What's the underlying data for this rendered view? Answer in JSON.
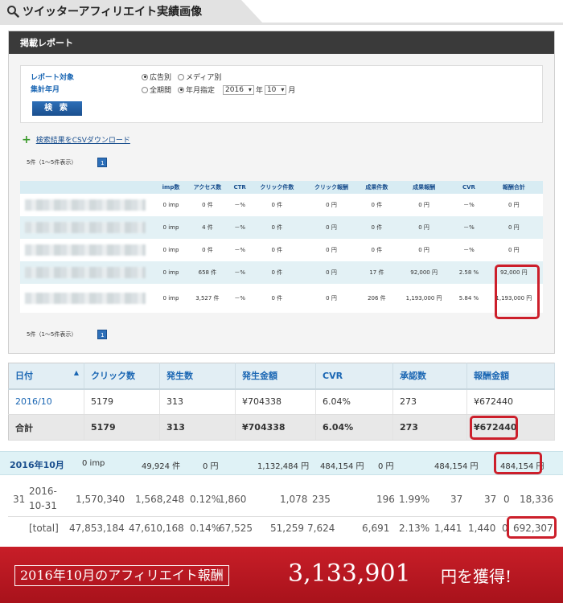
{
  "header": {
    "title": "ツイッターアフィリエイト実績画像"
  },
  "panel1": {
    "bar_title": "掲載レポート",
    "filter": {
      "label_target": "レポート対象",
      "label_period": "集計年月",
      "radio_ad": "広告別",
      "radio_media": "メディア別",
      "radio_all": "全期間",
      "radio_month": "年月指定",
      "year": "2016",
      "year_unit": "年",
      "month": "10",
      "month_unit": "月",
      "search_label": "検 索"
    },
    "csv_label": "検索結果をCSVダウンロード",
    "pager_text": "5件（1～5件表示）",
    "pager_page": "1",
    "columns": [
      "imp数",
      "アクセス数",
      "CTR",
      "クリック件数",
      "クリック報酬",
      "成果件数",
      "成果報酬",
      "CVR",
      "報酬合計"
    ],
    "rows": [
      [
        "0 imp",
        "0 件",
        "－%",
        "0 件",
        "0 円",
        "0 件",
        "0 円",
        "－%",
        "0 円"
      ],
      [
        "0 imp",
        "4 件",
        "－%",
        "0 件",
        "0 円",
        "0 件",
        "0 円",
        "－%",
        "0 円"
      ],
      [
        "0 imp",
        "0 件",
        "－%",
        "0 件",
        "0 円",
        "0 件",
        "0 円",
        "－%",
        "0 円"
      ],
      [
        "0 imp",
        "658 件",
        "－%",
        "0 件",
        "0 円",
        "17 件",
        "92,000 円",
        "2.58 %",
        "92,000 円"
      ],
      [
        "0 imp",
        "3,527 件",
        "－%",
        "0 件",
        "0 円",
        "206 件",
        "1,193,000 円",
        "5.84 %",
        "1,193,000 円"
      ]
    ]
  },
  "table2": {
    "columns": [
      "日付",
      "クリック数",
      "発生数",
      "発生金額",
      "CVR",
      "承認数",
      "報酬金額"
    ],
    "sort_icon": "▲",
    "rows": [
      [
        "2016/10",
        "5179",
        "313",
        "¥704338",
        "6.04%",
        "273",
        "¥672440"
      ],
      [
        "合計",
        "5179",
        "313",
        "¥704338",
        "6.04%",
        "273",
        "¥672440"
      ]
    ]
  },
  "row3": {
    "date": "2016年10月",
    "imp": "0 imp",
    "count": "49,924 件",
    "yen1": "0 円",
    "v1": "1,132,484 円",
    "v2": "484,154 円",
    "yen2": "0 円",
    "v3": "484,154 円",
    "v4": "484,154 円"
  },
  "table4": {
    "row1": {
      "day": "31",
      "date1": "2016-",
      "date2": "10-31",
      "c1": "1,570,340",
      "c2": "1,568,248",
      "c3": "0.12%",
      "c4": "1,860",
      "c5": "1,078",
      "c6": "235",
      "c7": "196",
      "c8": "1.99%",
      "c9": "37",
      "c10": "37",
      "c11": "0",
      "c12": "18,336"
    },
    "row2": {
      "label": "[total]",
      "c1": "47,853,184",
      "c2": "47,610,168",
      "c3": "0.14%",
      "c4": "67,525",
      "c5": "51,259",
      "c6": "7,624",
      "c7": "6,691",
      "c8": "2.13%",
      "c9": "1,441",
      "c10": "1,440",
      "c11": "0",
      "c12": "692,307"
    }
  },
  "banner": {
    "label": "2016年10月のアフィリエイト報酬",
    "amount": "3,133,901",
    "suffix": "円を獲得!"
  },
  "colors": {
    "accent": "#cc1f2b",
    "link": "#1a66b3",
    "highlight_row": "#dff2f6"
  }
}
